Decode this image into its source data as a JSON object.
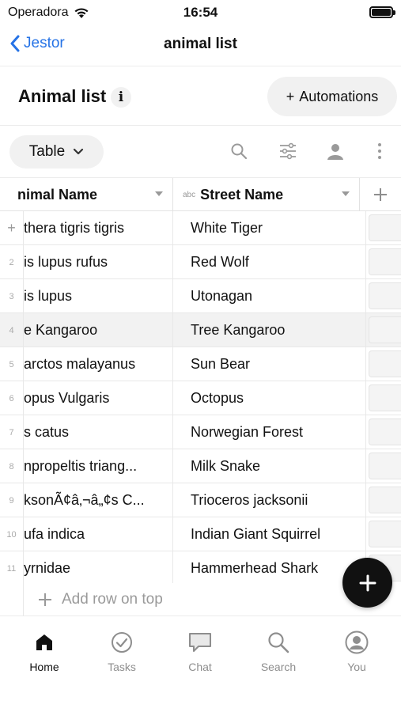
{
  "status_bar": {
    "carrier": "Operadora",
    "time": "16:54"
  },
  "navbar": {
    "back_label": "Jestor",
    "title": "animal list"
  },
  "header": {
    "list_title": "Animal list",
    "info_label": "i",
    "automations_label": "Automations",
    "automations_prefix": "+"
  },
  "toolbar": {
    "view_label": "Table"
  },
  "table": {
    "columns": [
      {
        "label": "nimal Name"
      },
      {
        "type_badge": "abc",
        "label": "Street Name"
      }
    ],
    "add_column_label": "+",
    "rows": [
      {
        "num": "+",
        "scientific": "thera tigris tigris",
        "street": "White Tiger",
        "thumb": "tiger"
      },
      {
        "num": "2",
        "scientific": "is lupus rufus",
        "street": "Red Wolf",
        "thumb": "wolf"
      },
      {
        "num": "3",
        "scientific": "is lupus",
        "street": "Utonagan",
        "thumb": "utonagan"
      },
      {
        "num": "4",
        "scientific": "e Kangaroo",
        "street": "Tree Kangaroo",
        "thumb": ""
      },
      {
        "num": "5",
        "scientific": "arctos malayanus",
        "street": "Sun Bear",
        "thumb": ""
      },
      {
        "num": "6",
        "scientific": "opus Vulgaris",
        "street": "Octopus",
        "thumb": "octopus"
      },
      {
        "num": "7",
        "scientific": "s catus",
        "street": "Norwegian Forest",
        "thumb": ""
      },
      {
        "num": "8",
        "scientific": "npropeltis triang...",
        "street": "Milk Snake",
        "thumb": "snake"
      },
      {
        "num": "9",
        "scientific": "ksonÃ¢â‚¬â„¢s C...",
        "street": "Trioceros jacksonii",
        "thumb": ""
      },
      {
        "num": "10",
        "scientific": "ufa indica",
        "street": "Indian Giant Squirrel",
        "thumb": ""
      },
      {
        "num": "11",
        "scientific": "yrnidae",
        "street": "Hammerhead Shark",
        "thumb": "shark"
      }
    ],
    "add_row_label": "Add row on top"
  },
  "fab_label": "+",
  "tabbar": {
    "items": [
      {
        "label": "Home",
        "icon": "home-icon",
        "active": true
      },
      {
        "label": "Tasks",
        "icon": "check-circle-icon",
        "active": false
      },
      {
        "label": "Chat",
        "icon": "chat-icon",
        "active": false
      },
      {
        "label": "Search",
        "icon": "search-icon",
        "active": false
      },
      {
        "label": "You",
        "icon": "user-icon",
        "active": false
      }
    ]
  },
  "colors": {
    "accent": "#2673e6",
    "fab": "#111111",
    "inactive_tab": "#8e8e8e"
  }
}
